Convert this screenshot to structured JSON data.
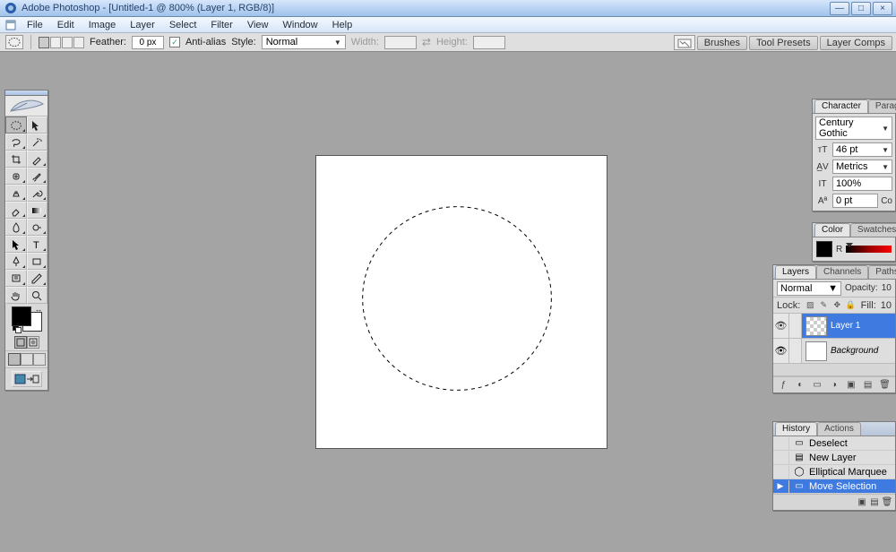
{
  "titlebar": {
    "title": "Adobe Photoshop - [Untitled-1 @ 800% (Layer 1, RGB/8)]"
  },
  "window_controls": {
    "min": "—",
    "max": "□",
    "close": "×"
  },
  "menu": {
    "file": "File",
    "edit": "Edit",
    "image": "Image",
    "layer": "Layer",
    "select": "Select",
    "filter": "Filter",
    "view": "View",
    "window": "Window",
    "help": "Help"
  },
  "options": {
    "feather_label": "Feather:",
    "feather_value": "0 px",
    "antialias_label": "Anti-alias",
    "antialias_checked": "✓",
    "style_label": "Style:",
    "style_value": "Normal",
    "width_label": "Width:",
    "height_label": "Height:"
  },
  "palette_well": {
    "brushes": "Brushes",
    "tool_presets": "Tool Presets",
    "layer_comps": "Layer Comps"
  },
  "character": {
    "tab_character": "Character",
    "tab_paragraph": "Paragraph",
    "font": "Century Gothic",
    "size": "46 pt",
    "kerning": "Metrics",
    "vscale": "100%",
    "baseline": "0 pt",
    "color_label": "Co"
  },
  "color": {
    "tab_color": "Color",
    "tab_swatches": "Swatches",
    "channel": "R"
  },
  "layers": {
    "tab_layers": "Layers",
    "tab_channels": "Channels",
    "tab_paths": "Paths",
    "blend": "Normal",
    "opacity_label": "Opacity:",
    "opacity_val": "10",
    "lock_label": "Lock:",
    "fill_label": "Fill:",
    "fill_val": "10",
    "items": [
      {
        "name": "Layer 1",
        "selected": true,
        "checker": true,
        "italic": false
      },
      {
        "name": "Background",
        "selected": false,
        "checker": false,
        "italic": true
      }
    ]
  },
  "history": {
    "tab_history": "History",
    "tab_actions": "Actions",
    "items": [
      {
        "name": "Deselect",
        "icon": "deselect",
        "sel": false
      },
      {
        "name": "New Layer",
        "icon": "newlayer",
        "sel": false
      },
      {
        "name": "Elliptical Marquee",
        "icon": "ellipse",
        "sel": false
      },
      {
        "name": "Move Selection",
        "icon": "move",
        "sel": true
      }
    ]
  }
}
